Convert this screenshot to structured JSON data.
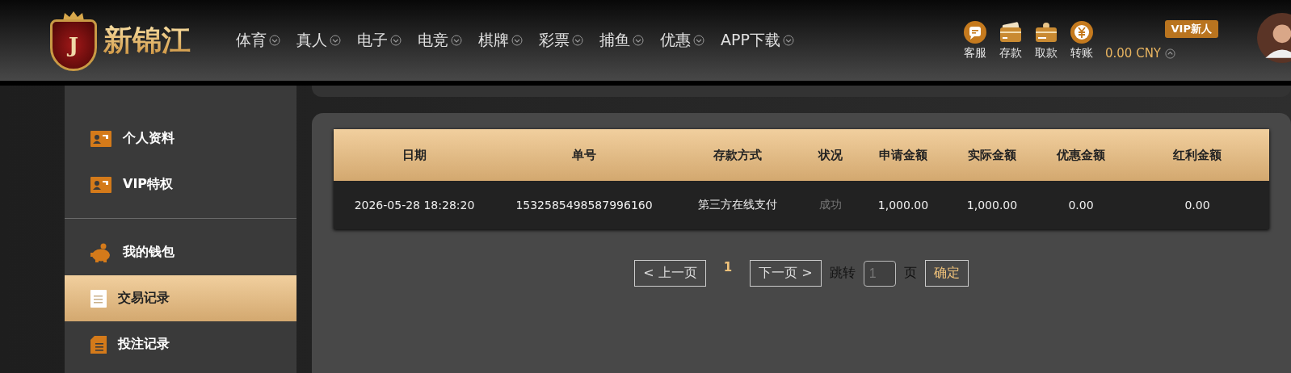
{
  "logo": {
    "badge_letter": "J",
    "name": "新锦江"
  },
  "nav": [
    {
      "label": "体育"
    },
    {
      "label": "真人"
    },
    {
      "label": "电子"
    },
    {
      "label": "电竞"
    },
    {
      "label": "棋牌"
    },
    {
      "label": "彩票"
    },
    {
      "label": "捕鱼"
    },
    {
      "label": "优惠"
    },
    {
      "label": "APP下载"
    }
  ],
  "header_actions": [
    {
      "kind": "chat",
      "label": "客服"
    },
    {
      "kind": "deposit",
      "label": "存款"
    },
    {
      "kind": "withdraw",
      "label": "取款"
    },
    {
      "kind": "transfer",
      "label": "转账"
    }
  ],
  "account": {
    "vip_badge": "VIP新人",
    "balance": "0.00 CNY"
  },
  "sidebar": {
    "groups": [
      [
        {
          "kind": "card",
          "label": "个人资料",
          "selected": false
        },
        {
          "kind": "card",
          "label": "VIP特权",
          "selected": false
        }
      ],
      [
        {
          "kind": "piggy",
          "label": "我的钱包",
          "selected": false
        },
        {
          "kind": "doc",
          "label": "交易记录",
          "selected": true
        },
        {
          "kind": "sheet",
          "label": "投注记录",
          "selected": false
        }
      ]
    ]
  },
  "table": {
    "columns": [
      "日期",
      "单号",
      "存款方式",
      "状况",
      "申请金额",
      "实际金额",
      "优惠金额",
      "红利金额"
    ],
    "rows": [
      {
        "cells": [
          {
            "text": "2026-05-28 18:28:20",
            "muted": false
          },
          {
            "text": "1532585498587996160",
            "muted": false
          },
          {
            "text": "第三方在线支付",
            "muted": false
          },
          {
            "text": "成功",
            "muted": true
          },
          {
            "text": "1,000.00",
            "muted": false
          },
          {
            "text": "1,000.00",
            "muted": false
          },
          {
            "text": "0.00",
            "muted": false
          },
          {
            "text": "0.00",
            "muted": false
          }
        ]
      }
    ]
  },
  "pagination": {
    "prev": "< 上一页",
    "pages": [
      {
        "label": "1",
        "selected": true
      }
    ],
    "next": "下一页 >",
    "jump_label": "跳转",
    "page_input": {
      "placeholder": "1"
    },
    "page_unit": "页",
    "confirm": "确定"
  }
}
